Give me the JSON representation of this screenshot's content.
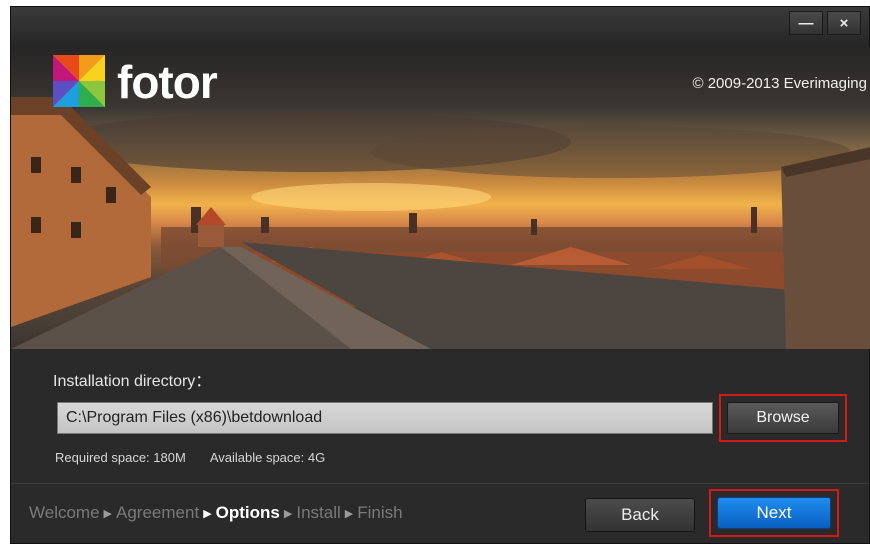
{
  "window": {
    "minimize_label": "—",
    "close_label": "×"
  },
  "brand": {
    "logo_text": "fotor",
    "copyright": "© 2009-2013 Everimaging"
  },
  "install": {
    "label": "Installation directory：",
    "path_value": "C:\\Program Files (x86)\\betdownload",
    "browse_label": "Browse",
    "required_space": "Required space:  180M",
    "available_space": "Available space:  4G"
  },
  "steps": [
    {
      "label": "Welcome",
      "active": false
    },
    {
      "label": "Agreement",
      "active": false
    },
    {
      "label": "Options",
      "active": true
    },
    {
      "label": "Install",
      "active": false
    },
    {
      "label": "Finish",
      "active": false
    }
  ],
  "footer": {
    "back_label": "Back",
    "next_label": "Next"
  },
  "colors": {
    "accent": "#1479e0",
    "highlight_border": "#d21a1a",
    "background": "#2a2a2a"
  }
}
